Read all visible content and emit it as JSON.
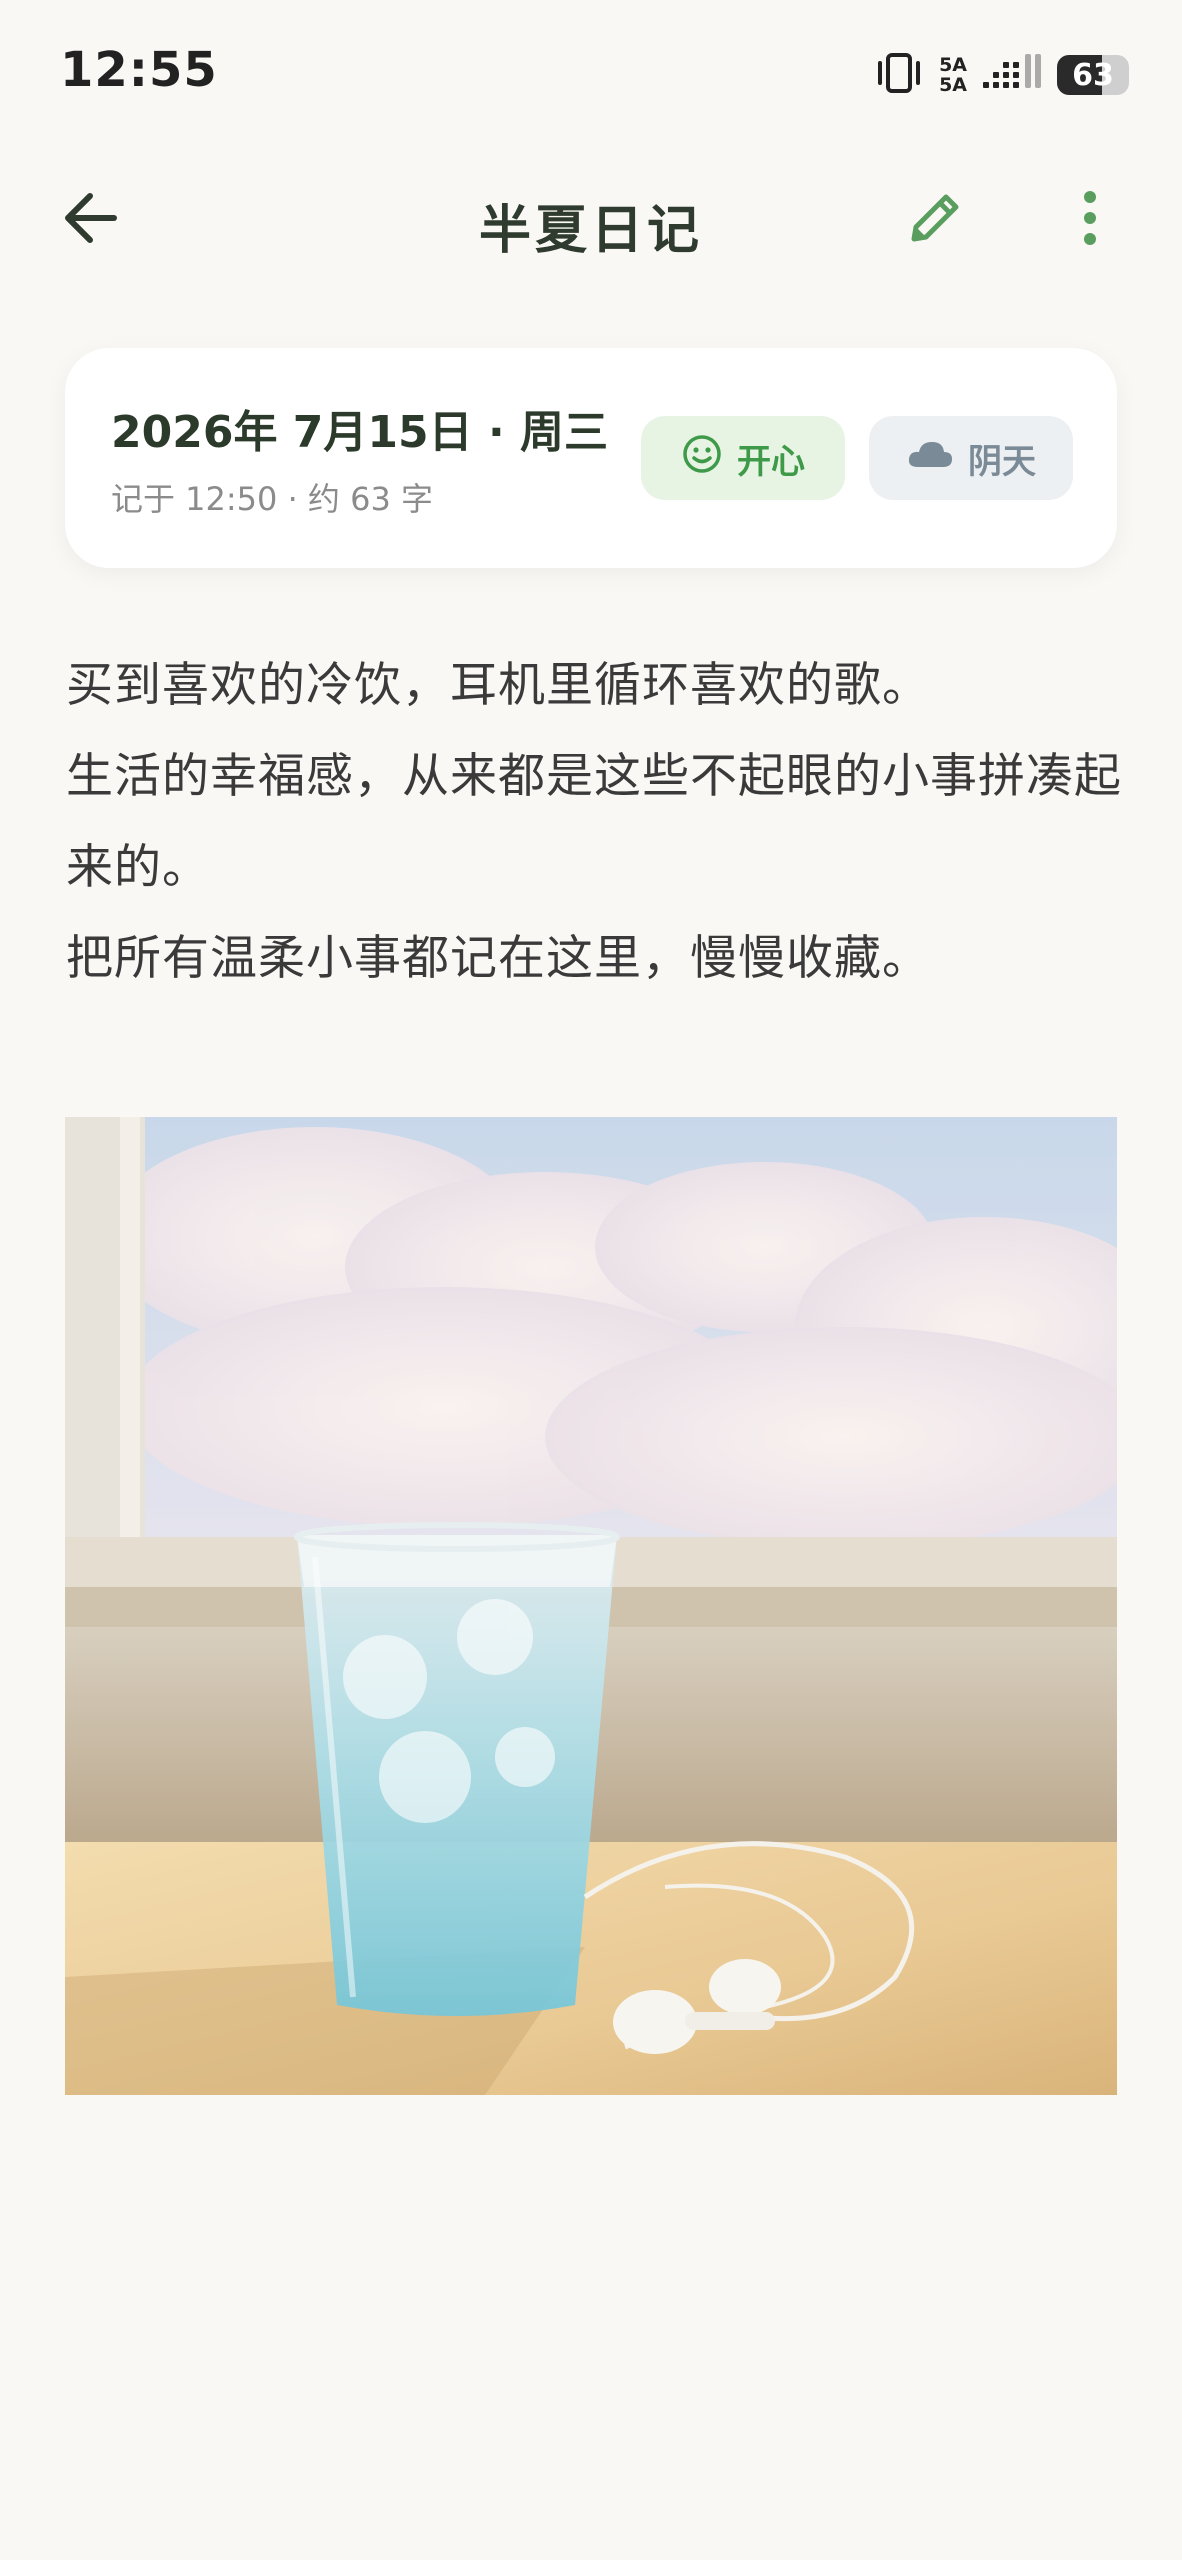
{
  "status_bar": {
    "time": "12:55",
    "network_label_top": "5A",
    "network_label_bottom": "5A",
    "battery_level": 63,
    "battery_text": "63",
    "icons": [
      "vibrate-icon",
      "signal-icon",
      "battery-icon"
    ]
  },
  "app_bar": {
    "title": "半夏日记",
    "icons": [
      "back-arrow-icon",
      "pencil-icon",
      "more-vert-icon"
    ]
  },
  "entry_meta": {
    "date": "2026年 7月15日 · 周三",
    "subtitle": "记于 12:50  ·  约 63 字",
    "mood": {
      "label": "开心",
      "icon": "smile-icon",
      "color": "#3e9a49"
    },
    "weather": {
      "label": "阴天",
      "icon": "cloud-icon",
      "color": "#7a8a96"
    }
  },
  "entry_body": {
    "lines": [
      "买到喜欢的冷饮，耳机里循环喜欢的歌。",
      "生活的幸福感，从来都是这些不起眼的小事拼凑起来的。",
      "把所有温柔小事都记在这里，慢慢收藏。"
    ]
  },
  "photo": {
    "subject": "glass of iced blue drink and earphones on a sunlit table by a window"
  },
  "colors": {
    "accent_green": "#5a9e5f",
    "title_dark": "#2f3b2e",
    "background": "#f9f8f5"
  }
}
